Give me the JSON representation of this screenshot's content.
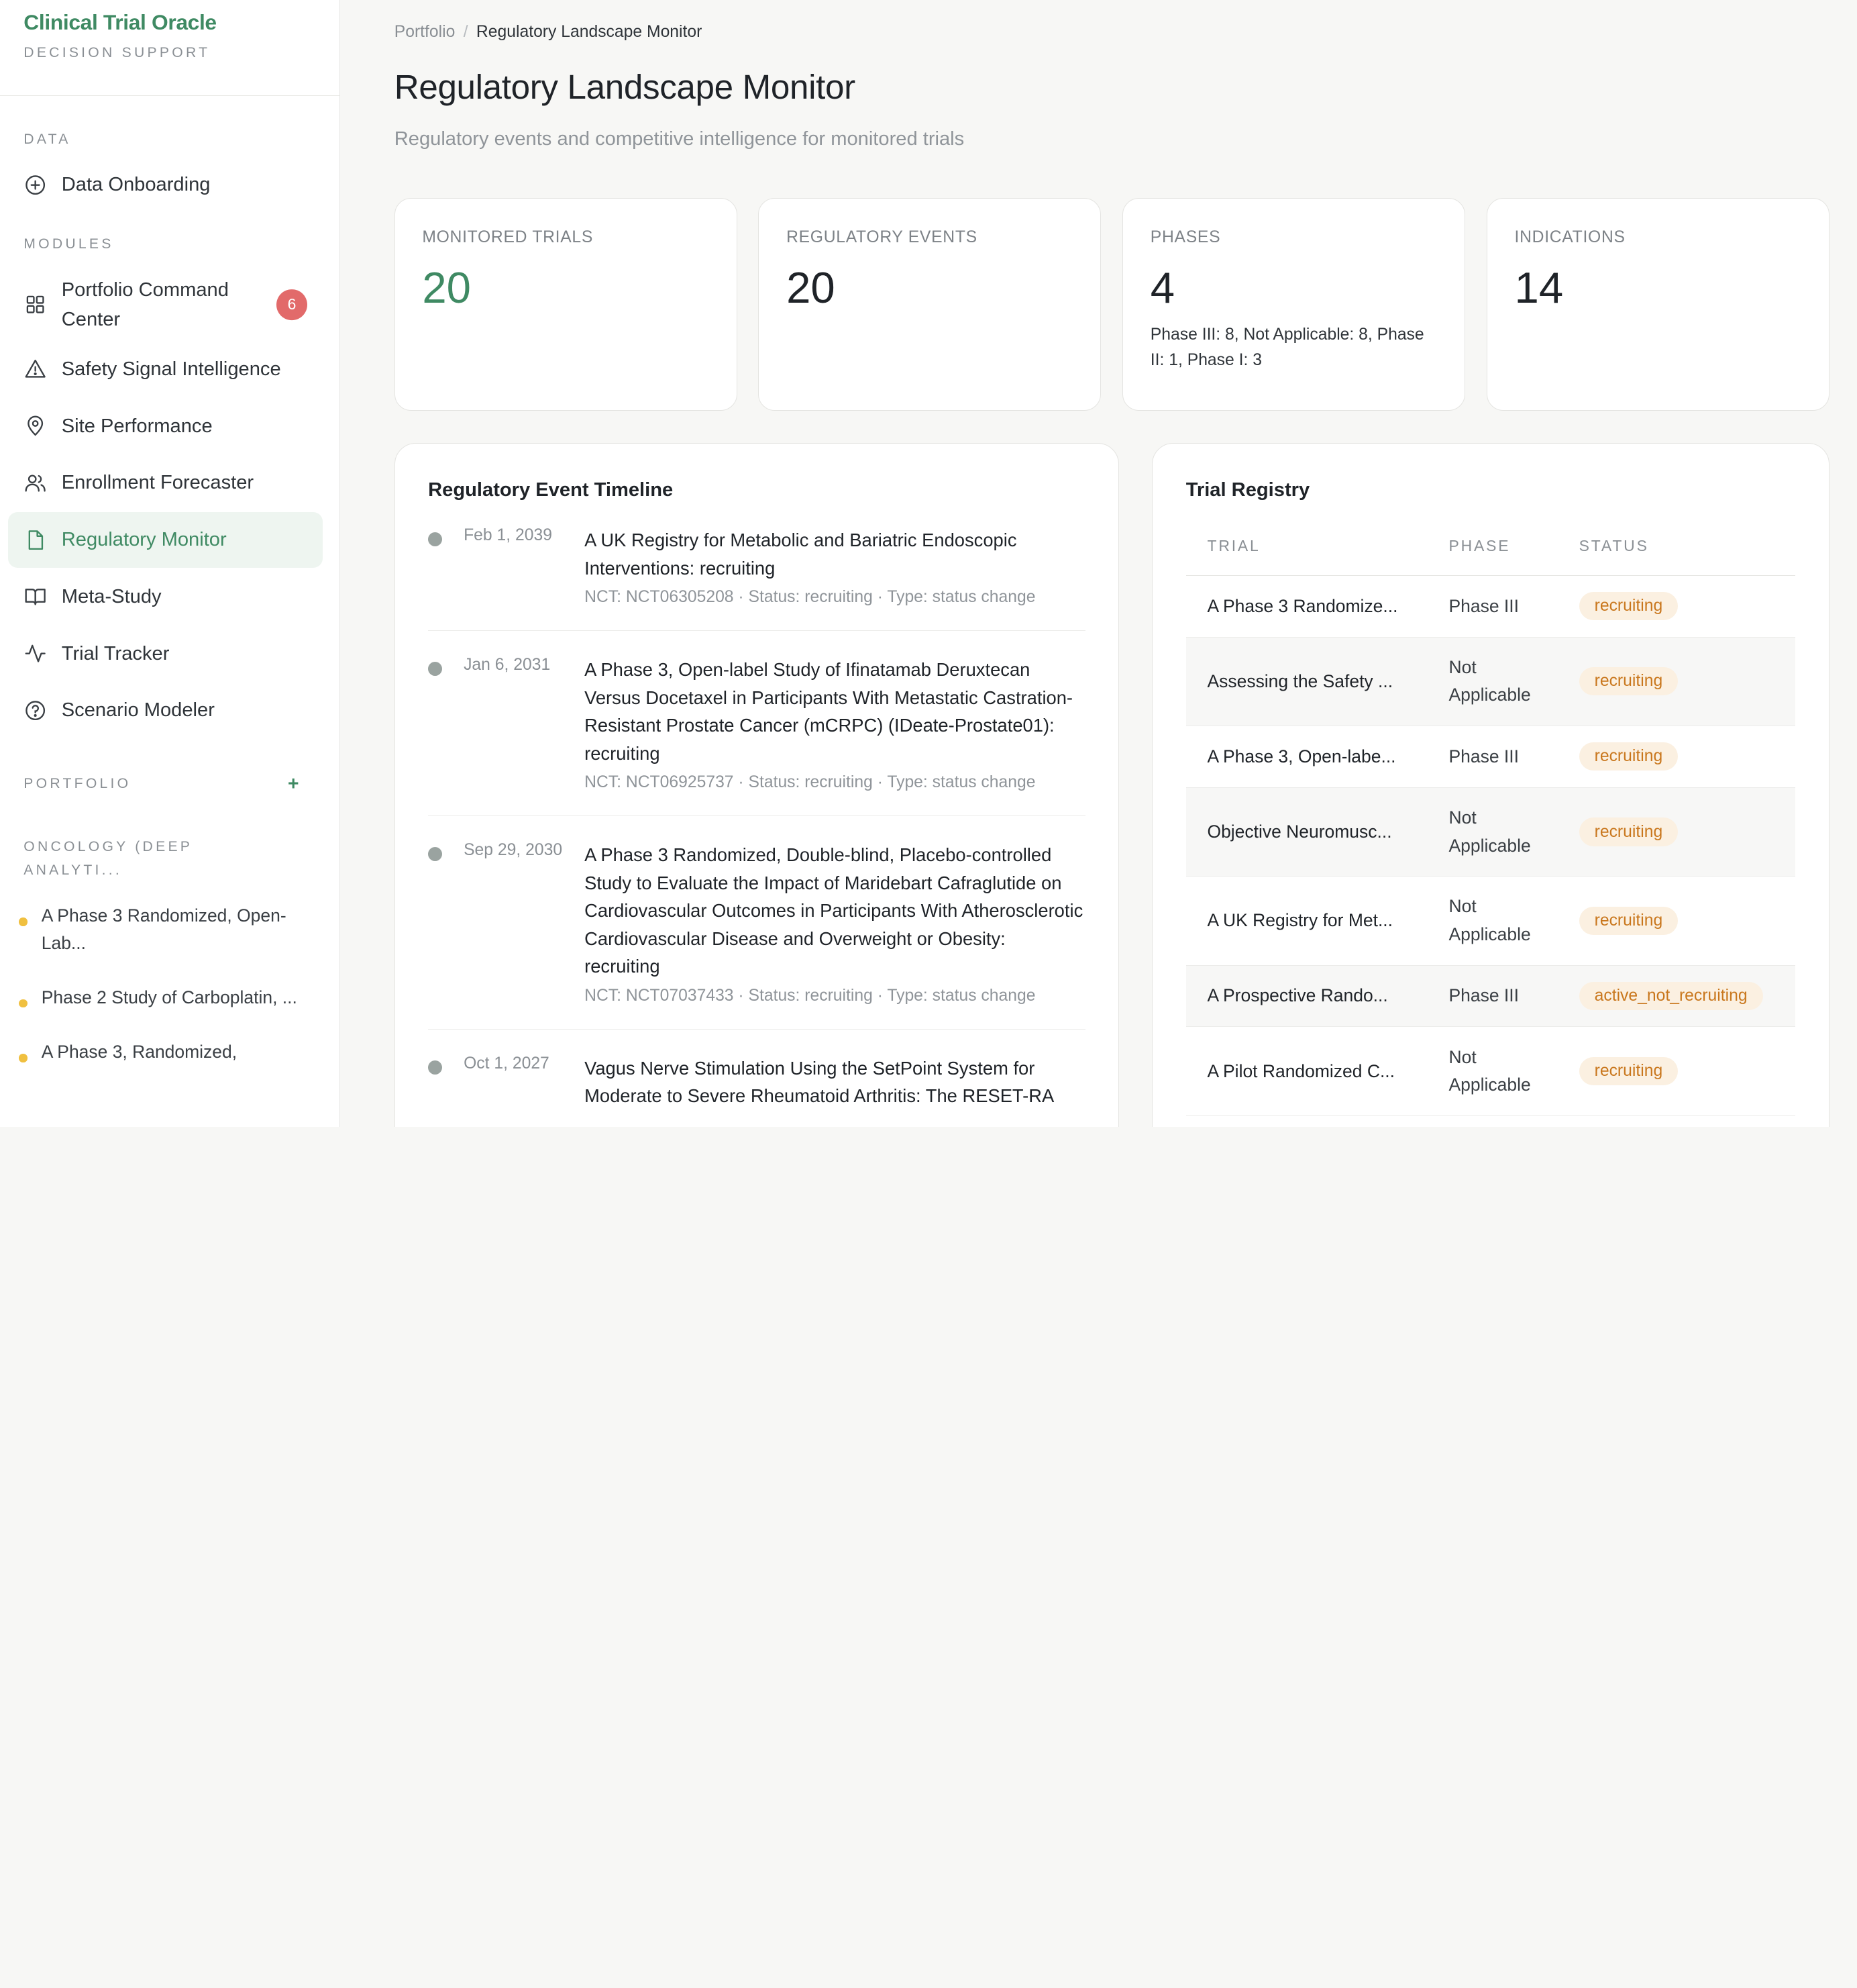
{
  "brand": {
    "title": "Clinical Trial Oracle",
    "subtitle": "DECISION SUPPORT"
  },
  "sidebar": {
    "data_label": "DATA",
    "data_items": [
      {
        "label": "Data Onboarding",
        "icon": "plus-circle-icon"
      }
    ],
    "modules_label": "MODULES",
    "modules": [
      {
        "label": "Portfolio Command Center",
        "icon": "grid-icon",
        "badge": "6"
      },
      {
        "label": "Safety Signal Intelligence",
        "icon": "warning-triangle-icon"
      },
      {
        "label": "Site Performance",
        "icon": "map-pin-icon"
      },
      {
        "label": "Enrollment Forecaster",
        "icon": "users-icon"
      },
      {
        "label": "Regulatory Monitor",
        "icon": "document-icon",
        "active": true
      },
      {
        "label": "Meta-Study",
        "icon": "book-open-icon"
      },
      {
        "label": "Trial Tracker",
        "icon": "activity-icon"
      },
      {
        "label": "Scenario Modeler",
        "icon": "help-circle-icon"
      }
    ],
    "portfolio_label": "PORTFOLIO",
    "portfolio_add": "+",
    "portfolio_group": "ONCOLOGY (DEEP ANALYTI...",
    "portfolio_items": [
      "A Phase 3 Randomized, Open-Lab...",
      "Phase 2 Study of Carboplatin, ...",
      "A Phase 3, Randomized,"
    ]
  },
  "breadcrumb": {
    "root": "Portfolio",
    "separator": "/",
    "current": "Regulatory Landscape Monitor"
  },
  "page": {
    "title": "Regulatory Landscape Monitor",
    "subtitle": "Regulatory events and competitive intelligence for monitored trials"
  },
  "stats": [
    {
      "label": "MONITORED TRIALS",
      "value": "20",
      "note": ""
    },
    {
      "label": "REGULATORY EVENTS",
      "value": "20",
      "note": ""
    },
    {
      "label": "PHASES",
      "value": "4",
      "note": "Phase III: 8, Not Applicable: 8, Phase II: 1, Phase I: 3"
    },
    {
      "label": "INDICATIONS",
      "value": "14",
      "note": ""
    }
  ],
  "timeline": {
    "title": "Regulatory Event Timeline",
    "events": [
      {
        "date": "Feb 1, 2039",
        "title": "A UK Registry for Metabolic and Bariatric Endoscopic Interventions: recruiting",
        "meta": "NCT: NCT06305208 · Status: recruiting · Type: status change"
      },
      {
        "date": "Jan 6, 2031",
        "title": "A Phase 3, Open-label Study of Ifinatamab Deruxtecan Versus Docetaxel in Participants With Metastatic Castration-Resistant Prostate Cancer (mCRPC) (IDeate-Prostate01): recruiting",
        "meta": "NCT: NCT06925737 · Status: recruiting · Type: status change"
      },
      {
        "date": "Sep 29, 2030",
        "title": "A Phase 3 Randomized, Double-blind, Placebo-controlled Study to Evaluate the Impact of Maridebart Cafraglutide on Cardiovascular Outcomes in Participants With Atherosclerotic Cardiovascular Disease and Overweight or Obesity: recruiting",
        "meta": "NCT: NCT07037433 · Status: recruiting · Type: status change"
      },
      {
        "date": "Oct 1, 2027",
        "title": "Vagus Nerve Stimulation Using the SetPoint System for Moderate to Severe Rheumatoid Arthritis: The RESET-RA",
        "meta": ""
      }
    ]
  },
  "registry": {
    "title": "Trial Registry",
    "columns": [
      "TRIAL",
      "PHASE",
      "STATUS"
    ],
    "rows": [
      {
        "trial": "A Phase 3 Randomize...",
        "phase": "Phase III",
        "status": "recruiting"
      },
      {
        "trial": "Assessing the Safety ...",
        "phase": "Not Applicable",
        "status": "recruiting"
      },
      {
        "trial": "A Phase 3, Open-labe...",
        "phase": "Phase III",
        "status": "recruiting"
      },
      {
        "trial": "Objective Neuromusc...",
        "phase": "Not Applicable",
        "status": "recruiting"
      },
      {
        "trial": "A UK Registry for Met...",
        "phase": "Not Applicable",
        "status": "recruiting"
      },
      {
        "trial": "A Prospective Rando...",
        "phase": "Phase III",
        "status": "active_not_recruiting"
      },
      {
        "trial": "A Pilot Randomized C...",
        "phase": "Not Applicable",
        "status": "recruiting"
      }
    ]
  },
  "colors": {
    "accent": "#3f8a63",
    "badge": "#e26a6a",
    "status_pill_bg": "#fbf0e1",
    "status_pill_text": "#c9771d",
    "portfolio_dot": "#f0c040"
  }
}
